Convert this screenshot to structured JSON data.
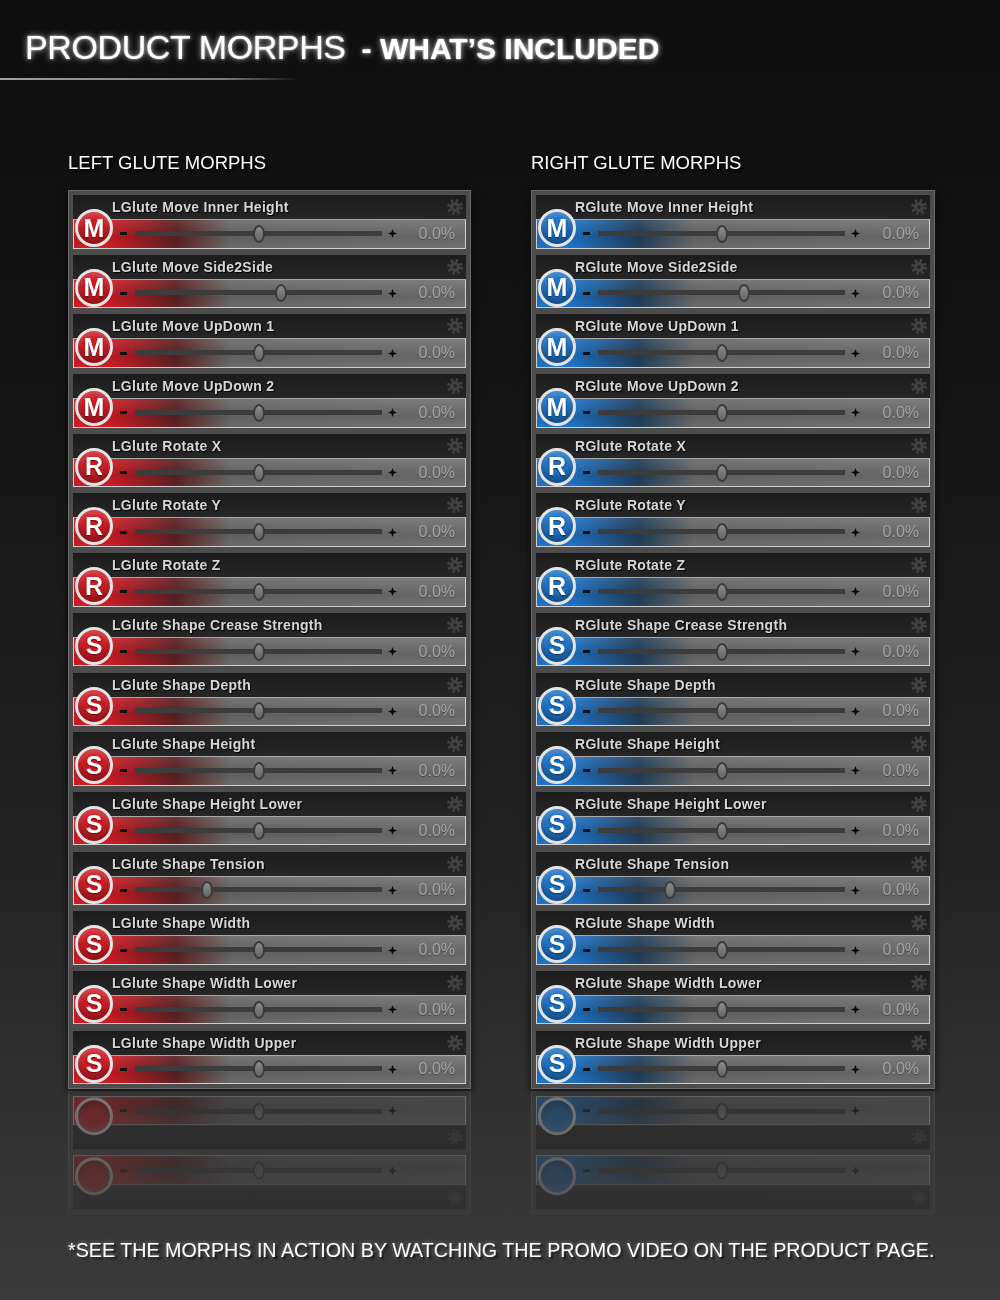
{
  "title": "PRODUCT MORPHS",
  "subtitle": "- WHAT’S INCLUDED",
  "panels": [
    {
      "heading": "LEFT GLUTE MORPHS",
      "color": "#d01c24",
      "morphs": [
        {
          "badge": "M",
          "label": "LGlute Move Inner Height",
          "level": 0.5,
          "value": "0.0%"
        },
        {
          "badge": "M",
          "label": "LGlute Move Side2Side",
          "level": 0.59,
          "value": "0.0%"
        },
        {
          "badge": "M",
          "label": "LGlute Move UpDown 1",
          "level": 0.5,
          "value": "0.0%"
        },
        {
          "badge": "M",
          "label": "LGlute Move UpDown 2",
          "level": 0.5,
          "value": "0.0%"
        },
        {
          "badge": "R",
          "label": "LGlute Rotate X",
          "level": 0.5,
          "value": "0.0%"
        },
        {
          "badge": "R",
          "label": "LGlute Rotate Y",
          "level": 0.5,
          "value": "0.0%"
        },
        {
          "badge": "R",
          "label": "LGlute Rotate Z",
          "level": 0.5,
          "value": "0.0%"
        },
        {
          "badge": "S",
          "label": "LGlute Shape Crease Strength",
          "level": 0.5,
          "value": "0.0%"
        },
        {
          "badge": "S",
          "label": "LGlute Shape Depth",
          "level": 0.5,
          "value": "0.0%"
        },
        {
          "badge": "S",
          "label": "LGlute Shape Height",
          "level": 0.5,
          "value": "0.0%"
        },
        {
          "badge": "S",
          "label": "LGlute Shape Height Lower",
          "level": 0.5,
          "value": "0.0%"
        },
        {
          "badge": "S",
          "label": "LGlute Shape Tension",
          "level": 0.29,
          "value": "0.0%"
        },
        {
          "badge": "S",
          "label": "LGlute Shape Width",
          "level": 0.5,
          "value": "0.0%"
        },
        {
          "badge": "S",
          "label": "LGlute Shape Width Lower",
          "level": 0.5,
          "value": "0.0%"
        },
        {
          "badge": "S",
          "label": "LGlute Shape Width Upper",
          "level": 0.5,
          "value": "0.0%"
        }
      ]
    },
    {
      "heading": "RIGHT GLUTE MORPHS",
      "color": "#1f74c8",
      "morphs": [
        {
          "badge": "M",
          "label": "RGlute Move Inner Height",
          "level": 0.5,
          "value": "0.0%"
        },
        {
          "badge": "M",
          "label": "RGlute Move Side2Side",
          "level": 0.59,
          "value": "0.0%"
        },
        {
          "badge": "M",
          "label": "RGlute Move UpDown 1",
          "level": 0.5,
          "value": "0.0%"
        },
        {
          "badge": "M",
          "label": "RGlute Move UpDown 2",
          "level": 0.5,
          "value": "0.0%"
        },
        {
          "badge": "R",
          "label": "RGlute Rotate X",
          "level": 0.5,
          "value": "0.0%"
        },
        {
          "badge": "R",
          "label": "RGlute Rotate Y",
          "level": 0.5,
          "value": "0.0%"
        },
        {
          "badge": "R",
          "label": "RGlute Rotate Z",
          "level": 0.5,
          "value": "0.0%"
        },
        {
          "badge": "S",
          "label": "RGlute Shape Crease Strength",
          "level": 0.5,
          "value": "0.0%"
        },
        {
          "badge": "S",
          "label": "RGlute Shape Depth",
          "level": 0.5,
          "value": "0.0%"
        },
        {
          "badge": "S",
          "label": "RGlute Shape Height",
          "level": 0.5,
          "value": "0.0%"
        },
        {
          "badge": "S",
          "label": "RGlute Shape Height Lower",
          "level": 0.5,
          "value": "0.0%"
        },
        {
          "badge": "S",
          "label": "RGlute Shape Tension",
          "level": 0.29,
          "value": "0.0%"
        },
        {
          "badge": "S",
          "label": "RGlute Shape Width",
          "level": 0.5,
          "value": "0.0%"
        },
        {
          "badge": "S",
          "label": "RGlute Shape Width Lower",
          "level": 0.5,
          "value": "0.0%"
        },
        {
          "badge": "S",
          "label": "RGlute Shape Width Upper",
          "level": 0.5,
          "value": "0.0%"
        }
      ]
    }
  ],
  "footnote": "*SEE THE MORPHS IN ACTION BY WATCHING THE PROMO VIDEO ON THE PRODUCT PAGE."
}
